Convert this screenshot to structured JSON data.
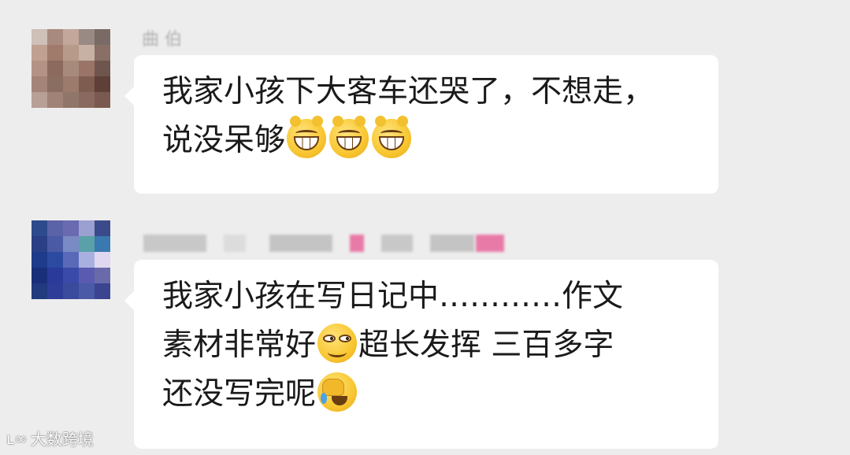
{
  "messages": [
    {
      "sender": "曲 伯",
      "lines": [
        "我家小孩下大客车还哭了，不想走，",
        "说没呆够"
      ],
      "emojis_line2": [
        "grinning-face-icon",
        "grinning-face-icon",
        "grinning-face-icon"
      ]
    },
    {
      "sender": "",
      "lines": [
        "我家小孩在写日记中…………作文",
        "素材非常好",
        "超长发挥 三百多字",
        "还没写完呢"
      ],
      "emojis": [
        "smirking-face-icon",
        "facepalm-crying-icon"
      ]
    }
  ],
  "watermark": {
    "logo_text": "ʟ∞",
    "text": "大数跨境"
  },
  "colors": {
    "background": "#ededed",
    "bubble": "#ffffff",
    "text": "#1a1a1a",
    "emoji_yellow": "#f8c630",
    "sender_pink": "#e87aa8"
  }
}
